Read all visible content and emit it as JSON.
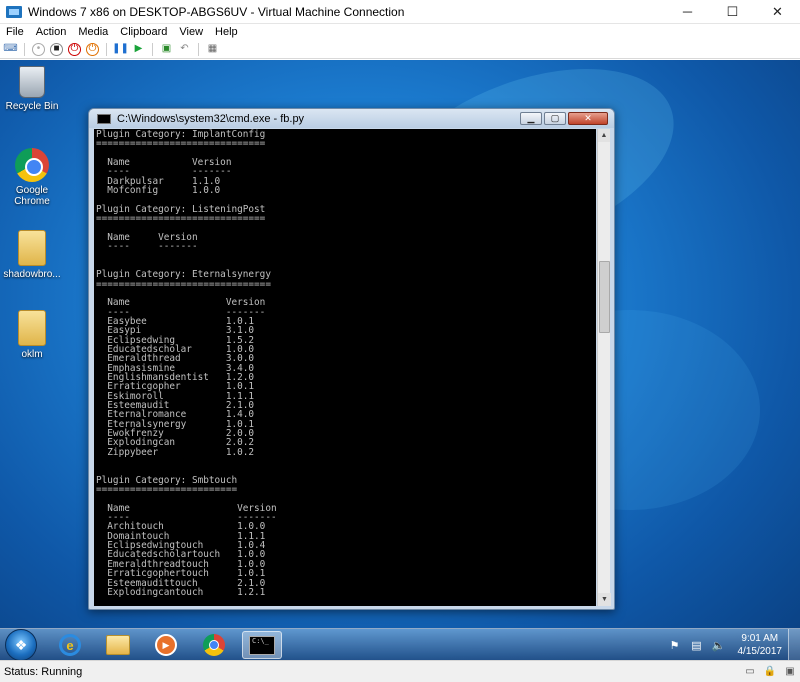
{
  "host": {
    "title": "Windows 7 x86 on DESKTOP-ABGS6UV - Virtual Machine Connection",
    "controls": {
      "minimize": "─",
      "maximize": "☐",
      "close": "✕"
    },
    "menu": [
      "File",
      "Action",
      "Media",
      "Clipboard",
      "View",
      "Help"
    ],
    "status": "Status: Running"
  },
  "desktop": {
    "icons": [
      {
        "label": "Recycle Bin"
      },
      {
        "label": "Google Chrome"
      },
      {
        "label": "shadowbro..."
      },
      {
        "label": "oklm"
      }
    ]
  },
  "cmd": {
    "title": "C:\\Windows\\system32\\cmd.exe - fb.py",
    "lines": [
      "Plugin Category: ImplantConfig",
      "==============================",
      "",
      "  Name           Version",
      "  ----           -------",
      "  Darkpulsar     1.1.0",
      "  Mofconfig      1.0.0",
      "",
      "Plugin Category: ListeningPost",
      "==============================",
      "",
      "  Name     Version",
      "  ----     -------",
      "",
      "",
      "Plugin Category: Eternalsynergy",
      "===============================",
      "",
      "  Name                 Version",
      "  ----                 -------",
      "  Easybee              1.0.1",
      "  Easypi               3.1.0",
      "  Eclipsedwing         1.5.2",
      "  Educatedscholar      1.0.0",
      "  Emeraldthread        3.0.0",
      "  Emphasismine         3.4.0",
      "  Englishmansdentist   1.2.0",
      "  Erraticgopher        1.0.1",
      "  Eskimoroll           1.1.1",
      "  Esteemaudit          2.1.0",
      "  Eternalromance       1.4.0",
      "  Eternalsynergy       1.0.1",
      "  Ewokfrenzy           2.0.0",
      "  Explodingcan         2.0.2",
      "  Zippybeer            1.0.2",
      "",
      "",
      "Plugin Category: Smbtouch",
      "=========================",
      "",
      "  Name                   Version",
      "  ----                   -------",
      "  Architouch             1.0.0",
      "  Domaintouch            1.1.1",
      "  Eclipsedwingtouch      1.0.4",
      "  Educatedscholartouch   1.0.0",
      "  Emeraldthreadtouch     1.0.0",
      "  Erraticgophertouch     1.0.1",
      "  Esteemaudittouch       2.1.0",
      "  Explodingcantouch      1.2.1"
    ]
  },
  "taskbar": {
    "start_glyph": "❖",
    "ie_glyph": "e",
    "media_glyph": "▶",
    "cmd_glyph": "C:\\_",
    "clock_time": "9:01 AM",
    "clock_date": "4/15/2017"
  }
}
